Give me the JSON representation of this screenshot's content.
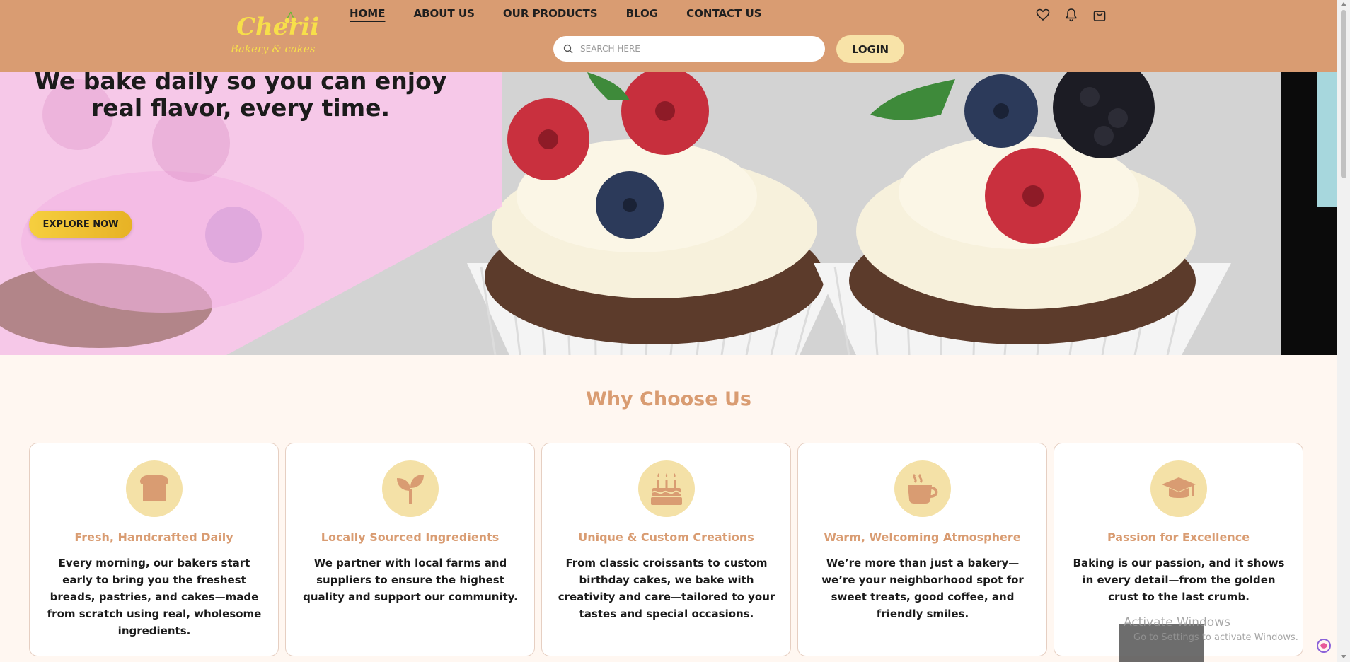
{
  "brand": {
    "name": "Cherii",
    "tagline": "Bakery & cakes",
    "accent_color": "#d99c72",
    "header_color": "#d99c72",
    "icon_circle_color": "#f4e1a7"
  },
  "nav": {
    "items": [
      {
        "label": "HOME",
        "active": true
      },
      {
        "label": "ABOUT US",
        "active": false
      },
      {
        "label": "OUR PRODUCTS",
        "active": false
      },
      {
        "label": "BLOG",
        "active": false
      },
      {
        "label": "CONTACT US",
        "active": false
      }
    ]
  },
  "search": {
    "placeholder": "SEARCH HERE",
    "value": "",
    "icon": "search-icon"
  },
  "login": {
    "label": "LOGIN"
  },
  "header_icons": [
    "heart-icon",
    "bell-icon",
    "shopping-bag-icon"
  ],
  "hero": {
    "headline_line1": "We bake daily so you can enjoy",
    "headline_line2": "real flavor, every time.",
    "cta_label": "EXPLORE NOW"
  },
  "why_choose_us": {
    "title": "Why Choose Us",
    "cards": [
      {
        "icon": "bread-icon",
        "title": "Fresh, Handcrafted Daily",
        "text": "Every morning, our bakers start early to bring you the freshest breads, pastries, and cakes—made from scratch using real, wholesome ingredients."
      },
      {
        "icon": "seedling-icon",
        "title": "Locally Sourced Ingredients",
        "text": "We partner with local farms and suppliers to ensure the highest quality and support our community."
      },
      {
        "icon": "birthday-cake-icon",
        "title": "Unique & Custom Creations",
        "text": "From classic croissants to custom birthday cakes, we bake with creativity and care—tailored to your tastes and special occasions."
      },
      {
        "icon": "coffee-cup-icon",
        "title": "Warm, Welcoming Atmosphere",
        "text": "We’re more than just a bakery—we’re your neighborhood spot for sweet treats, good coffee, and friendly smiles."
      },
      {
        "icon": "graduation-cap-icon",
        "title": "Passion for Excellence",
        "text": "Baking is our passion, and it shows in every detail—from the golden crust to the last crumb."
      }
    ]
  },
  "watermark": {
    "title": "Activate Windows",
    "subtitle": "Go to Settings to activate Windows."
  }
}
